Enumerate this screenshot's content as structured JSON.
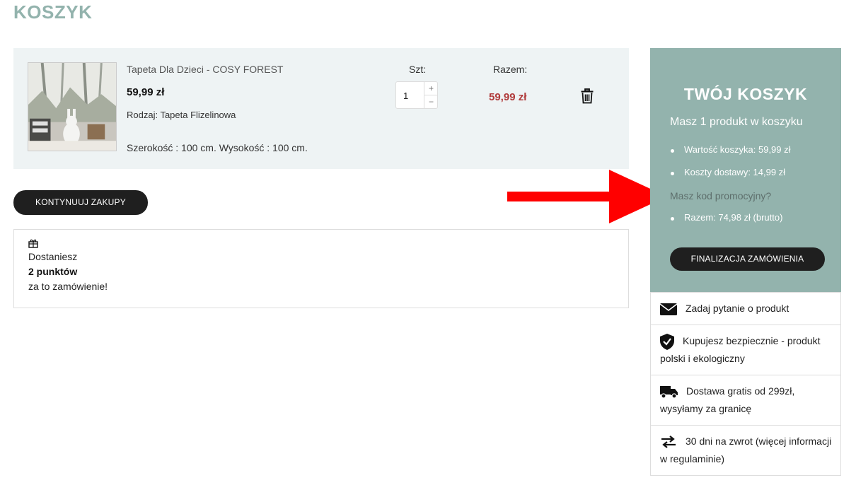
{
  "page": {
    "title": "KOSZYK"
  },
  "cart_item": {
    "name": "Tapeta Dla Dzieci - COSY FOREST",
    "price": "59,99 zł",
    "type": "Rodzaj: Tapeta Flizelinowa",
    "dimensions": "Szerokość : 100 cm. Wysokość : 100 cm.",
    "qty_label": "Szt:",
    "qty_value": "1",
    "qty_plus": "+",
    "qty_minus": "−",
    "total_label": "Razem:",
    "total_value": "59,99 zł"
  },
  "continue_button": "KONTYNUUJ ZAKUPY",
  "points": {
    "line1": "Dostaniesz",
    "line2": "2 punktów",
    "line3": "za to zamówienie!"
  },
  "summary": {
    "title": "TWÓJ KOSZYK",
    "count": "Masz 1 produkt w koszyku",
    "cart_value": "Wartość koszyka: 59,99 zł",
    "shipping": "Koszty dostawy: 14,99 zł",
    "promo": "Masz kod promocyjny?",
    "total": "Razem: 74,98 zł (brutto)",
    "checkout_button": "FINALIZACJA ZAMÓWIENIA"
  },
  "features": [
    {
      "icon": "envelope-icon",
      "text": "Zadaj pytanie o produkt"
    },
    {
      "icon": "shield-check-icon",
      "text": "Kupujesz bezpiecznie - produkt polski i ekologiczny"
    },
    {
      "icon": "truck-icon",
      "text": "Dostawa gratis od 299zł, wysyłamy za granicę"
    },
    {
      "icon": "exchange-icon",
      "text": "30 dni na zwrot (więcej informacji w regulaminie)"
    }
  ],
  "colors": {
    "accent": "#93b3ad",
    "item_bg": "#eef3f4",
    "price_red": "#b03a3a",
    "button_dark": "#1f1f1f",
    "arrow_red": "#ff0000"
  }
}
